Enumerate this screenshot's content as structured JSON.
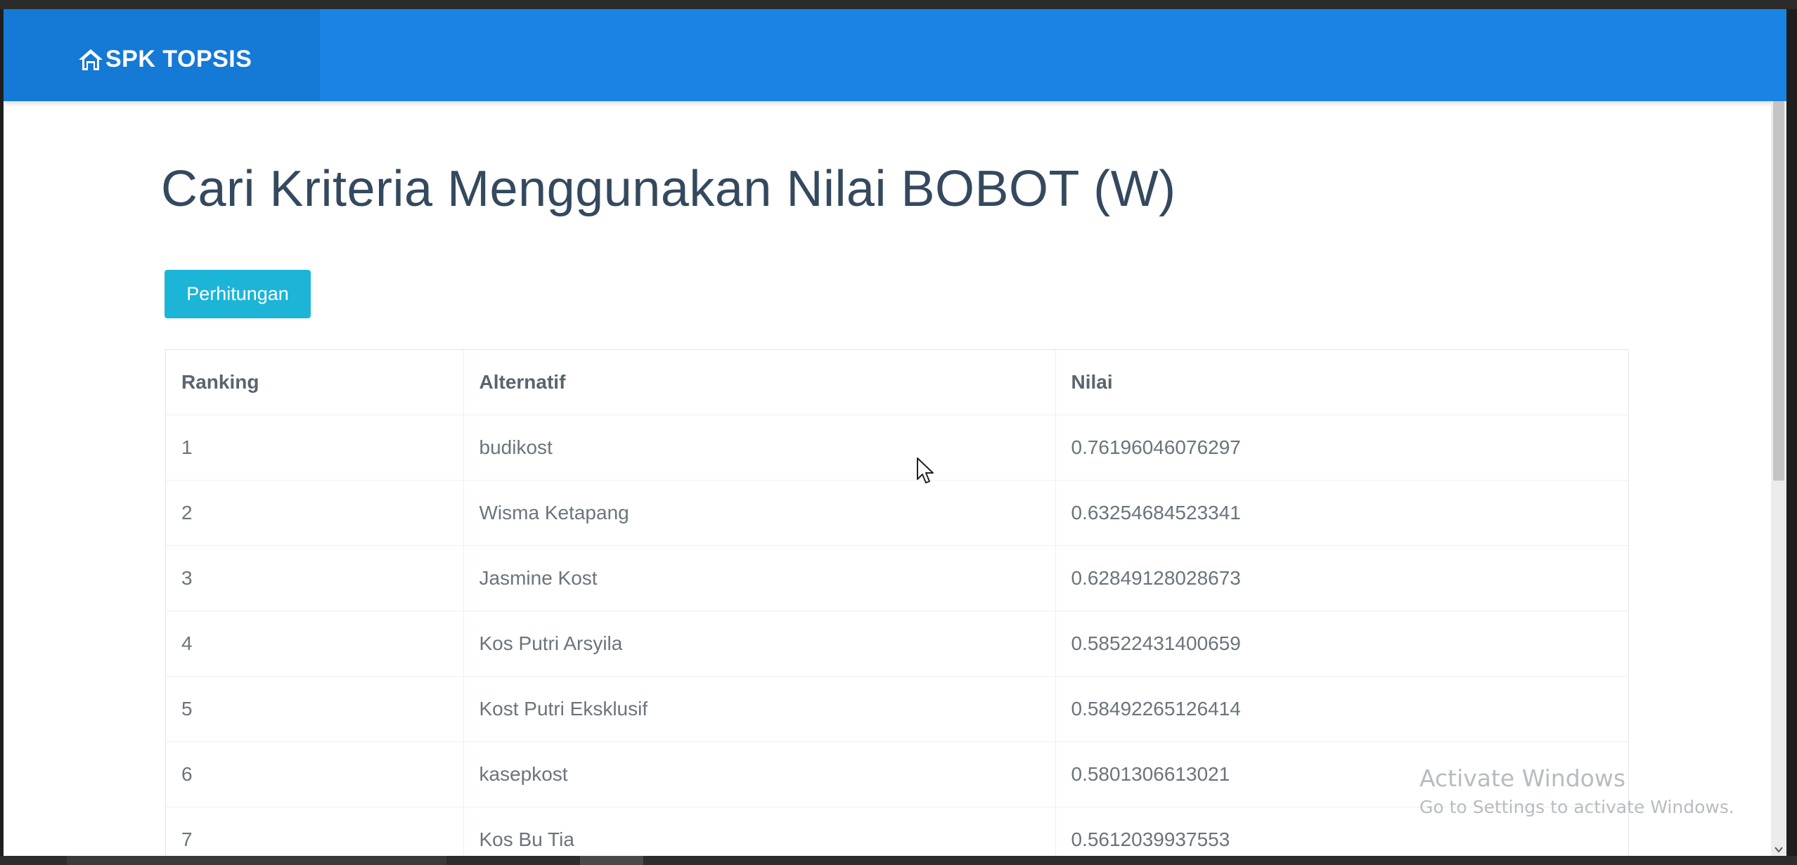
{
  "navbar": {
    "brand": "SPK TOPSIS",
    "brand_icon": "home-icon",
    "color": "#1a84e4"
  },
  "main": {
    "title": "Cari Kriteria Menggunakan Nilai BOBOT (W)",
    "button_label": "Perhitungan",
    "button_color": "#1cb5d8"
  },
  "table": {
    "headers": [
      "Ranking",
      "Alternatif",
      "Nilai"
    ],
    "rows": [
      {
        "rank": "1",
        "alternatif": "budikost",
        "nilai": "0.76196046076297"
      },
      {
        "rank": "2",
        "alternatif": "Wisma Ketapang",
        "nilai": "0.63254684523341"
      },
      {
        "rank": "3",
        "alternatif": "Jasmine Kost",
        "nilai": "0.62849128028673"
      },
      {
        "rank": "4",
        "alternatif": "Kos Putri Arsyila",
        "nilai": "0.58522431400659"
      },
      {
        "rank": "5",
        "alternatif": "Kost Putri Eksklusif",
        "nilai": "0.58492265126414"
      },
      {
        "rank": "6",
        "alternatif": "kasepkost",
        "nilai": "0.5801306613021"
      },
      {
        "rank": "7",
        "alternatif": "Kos Bu Tia",
        "nilai": "0.5612039937553"
      }
    ]
  },
  "watermark": {
    "title": "Activate Windows",
    "subtitle": "Go to Settings to activate Windows."
  }
}
